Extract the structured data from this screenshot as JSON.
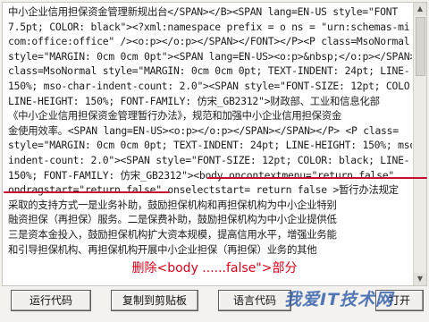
{
  "code_lines": [
    "中小企业信用担保资金管理新规出台</SPAN></B><SPAN lang=EN-US style=\"FONT",
    "7.5pt; COLOR: black\"><?xml:namespace prefix = o ns = \"urn:schemas-mi",
    "com:office:office\" /><o:p></o:p></SPAN></FONT></P><P class=MsoNormal",
    "style=\"MARGIN: 0cm 0cm 0pt\"><SPAN lang=EN-US><o:p>&nbsp;</o:p></SPAN>",
    "class=MsoNormal style=\"MARGIN: 0cm 0cm 0pt; TEXT-INDENT: 24pt; LINE-",
    "150%; mso-char-indent-count: 2.0\"><SPAN style=\"FONT-SIZE: 12pt; COLO",
    "LINE-HEIGHT: 150%; FONT-FAMILY: 仿宋_GB2312\">财政部、工业和信息化部",
    "《中小企业信用担保资金管理暂行办法》，规范和加强中小企业信用担保资金",
    "金使用效率。<SPAN lang=EN-US><o:p></o:p></SPAN></SPAN></P> <P class=",
    "style=\"MARGIN: 0cm 0cm 0pt; TEXT-INDENT: 24pt; LINE-HEIGHT: 150%; mso",
    "indent-count: 2.0\"><SPAN style=\"FONT-SIZE: 12pt; COLOR: black; LINE-",
    "150%; FONT-FAMILY: 仿宋_GB2312\"><body oncontextmenu=\"return false\"",
    "ondragstart=\"return false\" onselectstart= return false >暂行办法规定",
    "采取的支持方式一是业务补助，鼓励担保机构和再担保机构为中小企业特别",
    "融资担保（再担保）服务。二是保费补助，鼓励担保机构为中小企业提供低",
    "三是资本金投入，鼓励担保机构扩大资本规模，提高信用水平，增强业务能",
    "和引导担保机构、再担保机构开展中小企业担保（再担保）业务的其他"
  ],
  "annotation": {
    "caption": "删除<body ......false\">部分",
    "color": "#e0001a"
  },
  "highlight_color": "#c8102e",
  "buttons": [
    {
      "label": "运行代码"
    },
    {
      "label": "复制到剪贴板"
    },
    {
      "label": "语言代码"
    },
    {
      "label": "打开"
    }
  ],
  "watermark": "我爱IT技术网",
  "icons": {
    "scroll_up": "scroll-up-arrow-icon",
    "scroll_down": "scroll-down-arrow-icon"
  }
}
